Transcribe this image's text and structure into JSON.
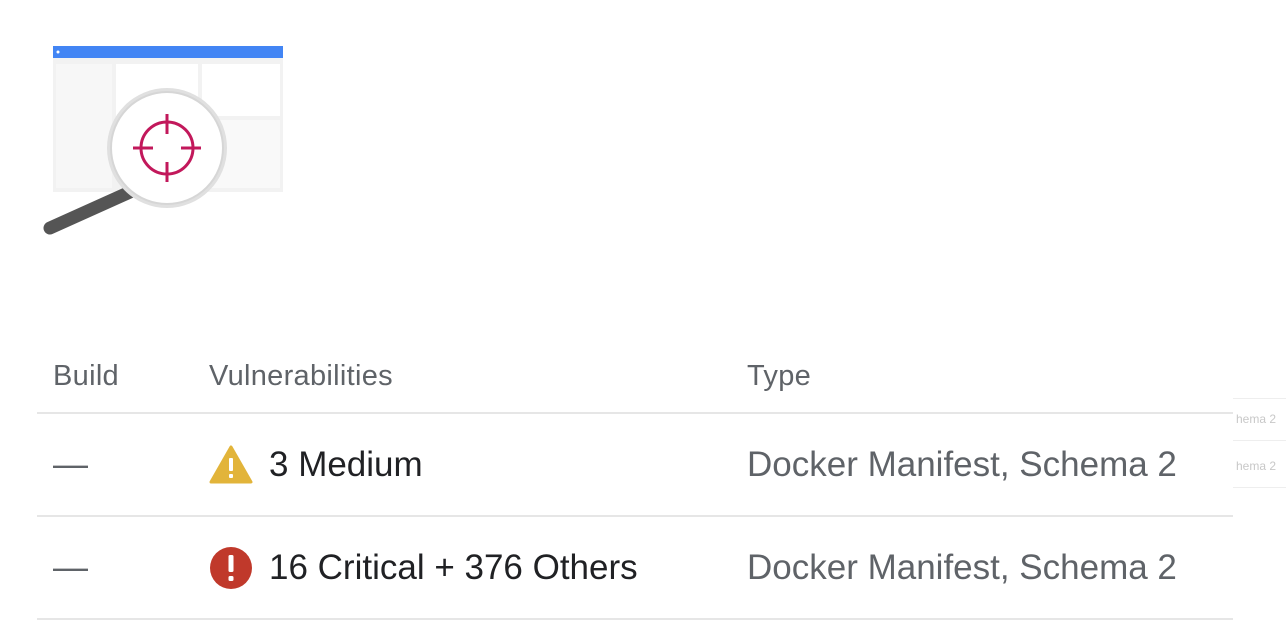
{
  "illustration": {
    "icon": "inspect-image-magnifier-icon",
    "accent_color": "#4285f4",
    "crosshair_color": "#c2185b"
  },
  "table": {
    "headers": {
      "build": "Build",
      "vulnerabilities": "Vulnerabilities",
      "type": "Type"
    },
    "rows": [
      {
        "build": "—",
        "severity_icon": "warning-triangle-icon",
        "severity_color": "#e2b43a",
        "vulnerabilities": "3 Medium",
        "type": "Docker Manifest, Schema 2"
      },
      {
        "build": "—",
        "severity_icon": "critical-error-icon",
        "severity_color": "#c0392b",
        "vulnerabilities": "16 Critical + 376 Others",
        "type": "Docker Manifest, Schema 2"
      }
    ]
  },
  "edge_fragments": [
    "hema 2",
    "hema 2"
  ]
}
